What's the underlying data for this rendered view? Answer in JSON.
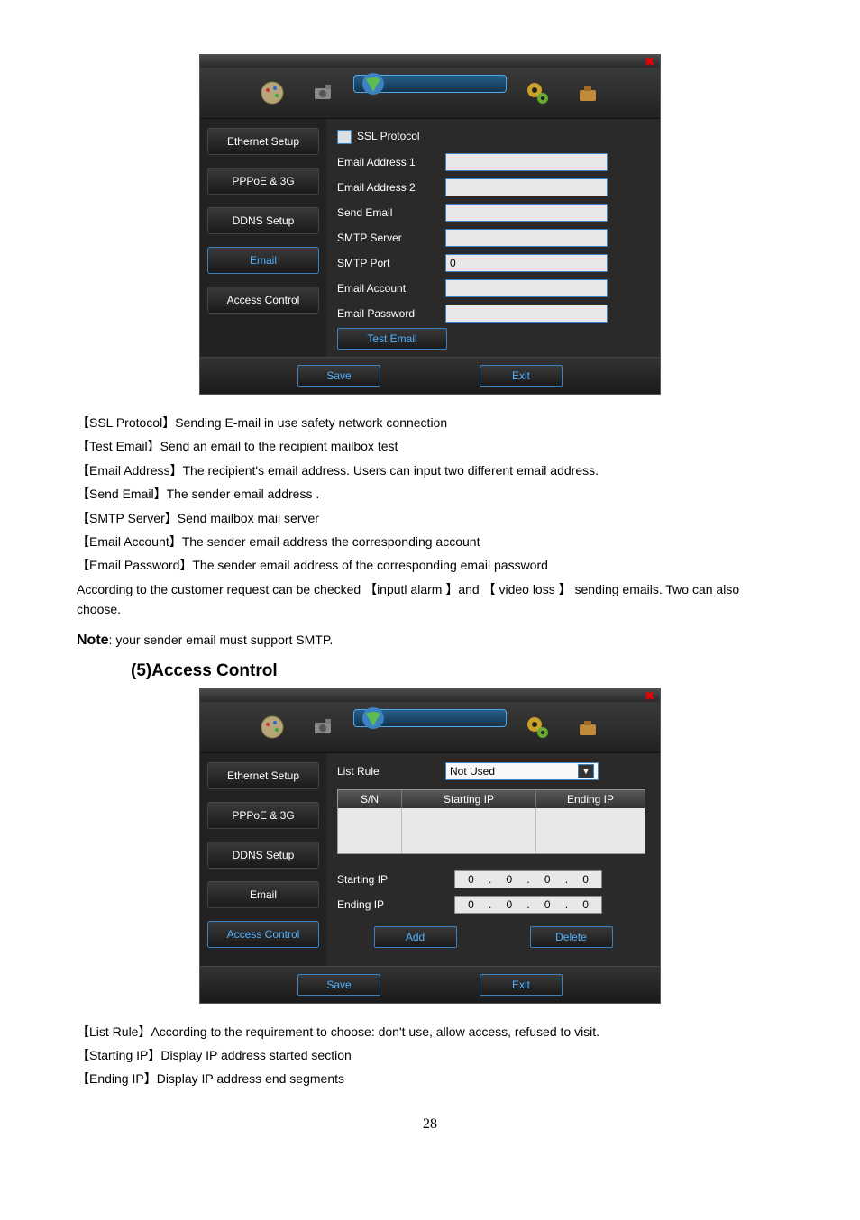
{
  "dialog1": {
    "side": [
      "Ethernet Setup",
      "PPPoE & 3G",
      "DDNS Setup",
      "Email",
      "Access Control"
    ],
    "active_index": 3,
    "fields": {
      "ssl": "SSL Protocol",
      "email1": "Email Address 1",
      "email2": "Email Address 2",
      "send": "Send Email",
      "smtp": "SMTP Server",
      "port_lbl": "SMTP Port",
      "port_val": "0",
      "acct": "Email Account",
      "pwd": "Email Password",
      "test": "Test Email"
    },
    "save": "Save",
    "exit": "Exit"
  },
  "descriptions1": [
    "【SSL Protocol】Sending E-mail in use safety network connection",
    "【Test Email】Send an email to the recipient mailbox test",
    "【Email Address】The recipient's email address. Users can input two different email address.",
    "【Send Email】The sender email address .",
    "【SMTP Server】Send mailbox mail server",
    "【Email Account】The sender email address the corresponding account",
    "【Email Password】The sender email address of the corresponding email password",
    "According to the customer request can be checked  【inputl alarm 】and 【  video loss 】 sending emails. Two can also choose."
  ],
  "note_prefix": "Note",
  "note_rest": ": your sender email must support SMTP.",
  "section_title": "(5)Access Control",
  "dialog2": {
    "side": [
      "Ethernet Setup",
      "PPPoE & 3G",
      "DDNS Setup",
      "Email",
      "Access Control"
    ],
    "active_index": 4,
    "list_rule_lbl": "List Rule",
    "list_rule_val": "Not Used",
    "table": {
      "h1": "S/N",
      "h2": "Starting IP",
      "h3": "Ending IP"
    },
    "starting_ip_lbl": "Starting IP",
    "ending_ip_lbl": "Ending IP",
    "ip_start": [
      "0",
      "0",
      "0",
      "0"
    ],
    "ip_end": [
      "0",
      "0",
      "0",
      "0"
    ],
    "add": "Add",
    "delete": "Delete",
    "save": "Save",
    "exit": "Exit"
  },
  "descriptions2": [
    "【List Rule】According to the requirement to choose: don't use, allow access, refused to visit.",
    "【Starting IP】Display IP address started section",
    "【Ending IP】Display IP address end segments"
  ],
  "page": "28"
}
